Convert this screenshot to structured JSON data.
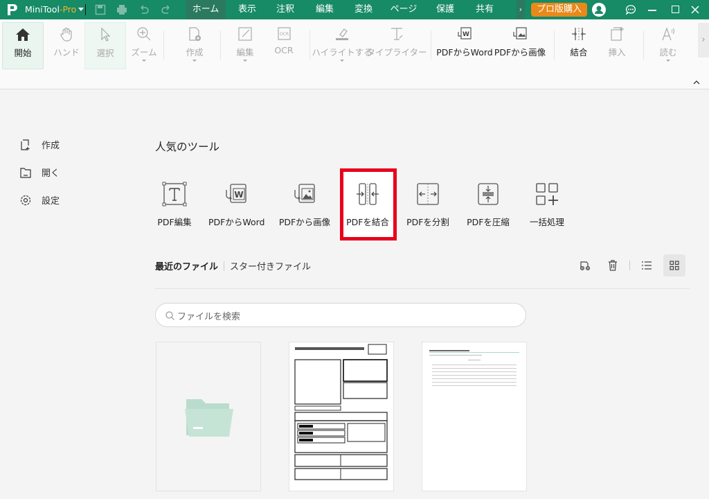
{
  "app": {
    "name": "MiniTool",
    "edition": "-Pro"
  },
  "menu_tabs": [
    "ホーム",
    "表示",
    "注釈",
    "編集",
    "変換",
    "ページ",
    "保護",
    "共有"
  ],
  "buy_button": "プロ版購入",
  "toolbar": {
    "start": "開始",
    "hand": "ハンド",
    "select": "選択",
    "zoom": "ズーム",
    "create": "作成",
    "edit": "編集",
    "ocr": "OCR",
    "highlight": "ハイライトする",
    "typewriter": "タイプライター",
    "pdf_to_word": "PDFからWord",
    "pdf_to_image": "PDFから画像",
    "merge": "結合",
    "insert": "挿入",
    "read": "読む"
  },
  "sidebar": {
    "items": [
      {
        "label": "作成",
        "icon": "new-file-icon"
      },
      {
        "label": "開く",
        "icon": "folder-icon"
      },
      {
        "label": "設定",
        "icon": "gear-icon"
      }
    ]
  },
  "popular": {
    "title": "人気のツール",
    "tools": [
      "PDF編集",
      "PDFからWord",
      "PDFから画像",
      "PDFを結合",
      "PDFを分割",
      "PDFを圧縮",
      "一括処理"
    ]
  },
  "recent": {
    "tab_recent": "最近のファイル",
    "tab_starred": "スター付きファイル"
  },
  "search": {
    "placeholder": "ファイルを検索"
  },
  "colors": {
    "brand": "#178a66",
    "buy": "#e8891a",
    "highlight": "#e8001c"
  }
}
